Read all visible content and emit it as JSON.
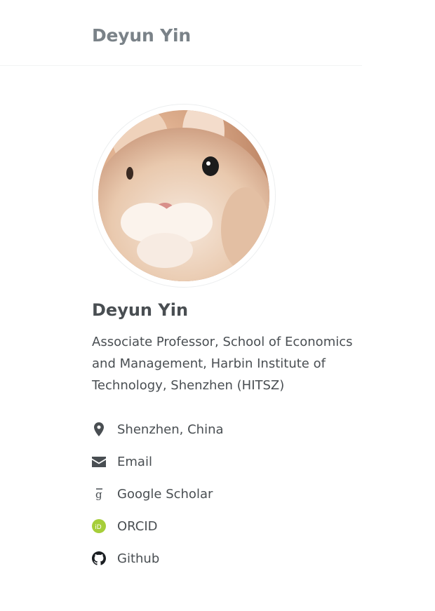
{
  "site": {
    "title": "Deyun Yin"
  },
  "author": {
    "name": "Deyun Yin",
    "bio": "Associate Professor, School of Economics and Management, Harbin Institute of Technology, Shenzhen (HITSZ)"
  },
  "links": [
    {
      "icon": "map-marker-icon",
      "label": "Shenzhen, China"
    },
    {
      "icon": "envelope-icon",
      "label": "Email"
    },
    {
      "icon": "google-scholar-icon",
      "label": "Google Scholar"
    },
    {
      "icon": "orcid-icon",
      "label": "ORCID"
    },
    {
      "icon": "github-icon",
      "label": "Github"
    }
  ],
  "colors": {
    "title": "#7a8288",
    "text": "#494e52",
    "orcid": "#a6ce39"
  }
}
